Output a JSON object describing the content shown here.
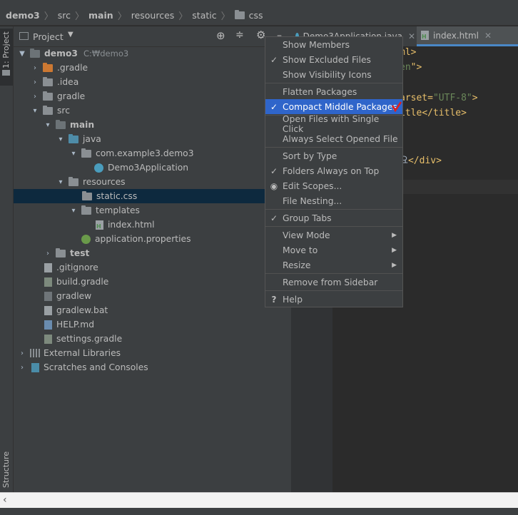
{
  "breadcrumb": [
    "demo3",
    "src",
    "main",
    "resources",
    "static",
    "css"
  ],
  "left_strip": {
    "project_tab": "1: Project",
    "structure_tab": "Structure"
  },
  "panel": {
    "title": "Project"
  },
  "tree": [
    {
      "label": "demo3",
      "suffix": "C:₩demo3"
    },
    {
      "label": ".gradle"
    },
    {
      "label": ".idea"
    },
    {
      "label": "gradle"
    },
    {
      "label": "src"
    },
    {
      "label": "main"
    },
    {
      "label": "java"
    },
    {
      "label": "com.example3.demo3"
    },
    {
      "label": "Demo3Application"
    },
    {
      "label": "resources"
    },
    {
      "label": "static.css"
    },
    {
      "label": "templates"
    },
    {
      "label": "index.html"
    },
    {
      "label": "application.properties"
    },
    {
      "label": "test"
    },
    {
      "label": ".gitignore"
    },
    {
      "label": "build.gradle"
    },
    {
      "label": "gradlew"
    },
    {
      "label": "gradlew.bat"
    },
    {
      "label": "HELP.md"
    },
    {
      "label": "settings.gradle"
    },
    {
      "label": "External Libraries"
    },
    {
      "label": "Scratches and Consoles"
    }
  ],
  "editor_tabs": [
    {
      "label": "Demo3Application.java"
    },
    {
      "label": "index.html"
    }
  ],
  "code": {
    "l1": "ml>",
    "l2a": "en",
    "l2b": "\">",
    "l3a": "arset=",
    "l3b": "\"UTF-8\"",
    "l3c": ">",
    "l4a": "itle",
    "l4b": "</title>",
    "l5a": "요",
    "l5b": "</div>"
  },
  "menu": {
    "items": [
      {
        "label": "Show Members",
        "mark": ""
      },
      {
        "label": "Show Excluded Files",
        "mark": "✓"
      },
      {
        "label": "Show Visibility Icons",
        "mark": ""
      },
      {
        "label": "Flatten Packages",
        "mark": ""
      },
      {
        "label": "Compact Middle Packages",
        "mark": "✓"
      },
      {
        "label": "Open Files with Single Click",
        "mark": ""
      },
      {
        "label": "Always Select Opened File",
        "mark": ""
      },
      {
        "label": "Sort by Type",
        "mark": ""
      },
      {
        "label": "Folders Always on Top",
        "mark": "✓"
      },
      {
        "label": "Edit Scopes...",
        "mark": "◉"
      },
      {
        "label": "File Nesting...",
        "mark": ""
      },
      {
        "label": "Group Tabs",
        "mark": "✓"
      },
      {
        "label": "View Mode",
        "mark": ""
      },
      {
        "label": "Move to",
        "mark": ""
      },
      {
        "label": "Resize",
        "mark": ""
      },
      {
        "label": "Remove from Sidebar",
        "mark": ""
      },
      {
        "label": "Help",
        "mark": "?"
      }
    ]
  },
  "colors": {
    "accent": "#2f65ca",
    "annotation_red": "#e0201b",
    "selection_row": "#0d293e"
  }
}
